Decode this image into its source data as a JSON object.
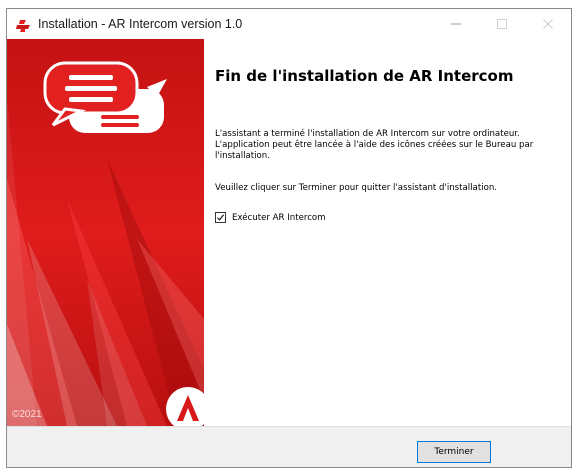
{
  "window": {
    "title": "Installation - AR Intercom version 1.0",
    "controls": {
      "minimize": "minimize-icon",
      "maximize": "maximize-icon",
      "close": "close-icon"
    }
  },
  "side_panel": {
    "copyright": "©2021",
    "colors": {
      "primary": "#d81919",
      "dark": "#a00e0e",
      "light": "#ff5a5a"
    }
  },
  "content": {
    "heading": "Fin de l'installation de AR Intercom",
    "paragraph1": "L'assistant a terminé l'installation de AR Intercom sur votre ordinateur. L'application peut être lancée à l'aide des icônes créées sur le Bureau par l'installation.",
    "paragraph2": "Veuillez cliquer sur Terminer pour quitter l'assistant d'installation.",
    "checkbox": {
      "label": "Exécuter AR Intercom",
      "checked": true
    }
  },
  "footer": {
    "finish_label": "Terminer",
    "accent_color": "#0078d7"
  }
}
